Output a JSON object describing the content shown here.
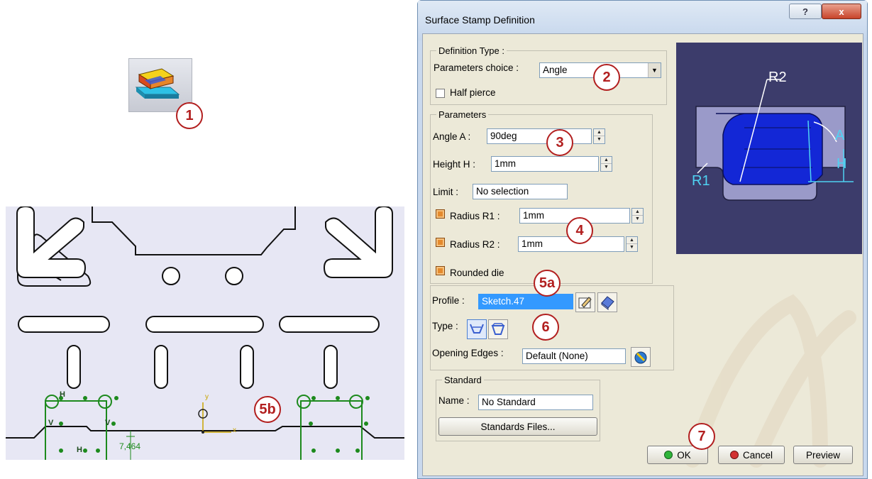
{
  "callouts": {
    "c1": "1",
    "c2": "2",
    "c3": "3",
    "c4": "4",
    "c5a": "5a",
    "c5b": "5b",
    "c6": "6",
    "c7": "7"
  },
  "toolbar": {
    "icon": "surface-stamp-icon"
  },
  "sketch": {
    "dimension": "7,464",
    "constraint_h": "H",
    "constraint_v": "V",
    "axis_x": "x",
    "axis_y": "y"
  },
  "dialog": {
    "title": "Surface Stamp Definition",
    "help": "?",
    "close": "x",
    "definition_type": {
      "legend": "Definition Type :",
      "parameters_choice_label": "Parameters choice :",
      "parameters_choice_value": "Angle",
      "half_pierce_label": "Half pierce",
      "half_pierce_checked": false
    },
    "parameters": {
      "legend": "Parameters",
      "angle_label": "Angle A :",
      "angle_value": "90deg",
      "height_label": "Height H :",
      "height_value": "1mm",
      "limit_label": "Limit :",
      "limit_value": "No selection",
      "radius_r1_label": "Radius R1 :",
      "radius_r1_value": "1mm",
      "radius_r1_checked": true,
      "radius_r2_label": "Radius R2 :",
      "radius_r2_value": "1mm",
      "radius_r2_checked": true,
      "rounded_die_label": "Rounded die",
      "rounded_die_checked": true
    },
    "profile": {
      "profile_label": "Profile :",
      "profile_value": "Sketch.47",
      "type_label": "Type :",
      "opening_edges_label": "Opening Edges :",
      "opening_edges_value": "Default (None)"
    },
    "standard": {
      "legend": "Standard",
      "name_label": "Name :",
      "name_value": "No Standard",
      "files_button": "Standards Files..."
    },
    "preview_image": {
      "r1": "R1",
      "r2": "R2",
      "a": "A",
      "h": "H"
    },
    "buttons": {
      "ok": "OK",
      "cancel": "Cancel",
      "preview": "Preview"
    }
  }
}
